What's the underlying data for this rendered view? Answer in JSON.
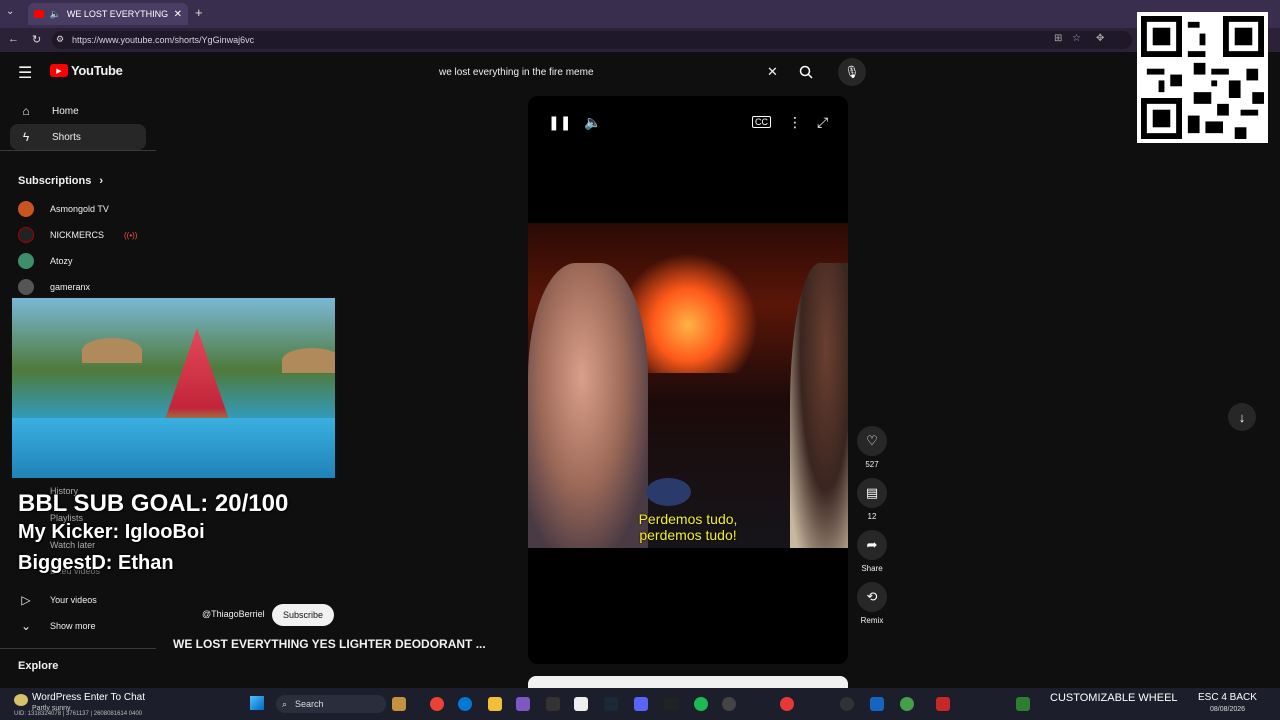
{
  "browser": {
    "tab_title": "WE LOST EVERYTHING YES LI",
    "url": "https://www.youtube.com/shorts/YgGinwaj6vc"
  },
  "yt": {
    "logo": "YouTube",
    "search_value": "we lost everything in the fire meme",
    "nav": [
      {
        "label": "Home",
        "icon": "home-icon"
      },
      {
        "label": "Shorts",
        "icon": "shorts-icon"
      }
    ],
    "subs_header": "Subscriptions",
    "subs": [
      "Asmongold TV",
      "NICKMERCS",
      "Atozy",
      "gameranx"
    ],
    "you_items": [
      "History",
      "Playlists",
      "Watch later",
      "Liked videos",
      "Your videos",
      "Show more"
    ],
    "explore": "Explore",
    "channel": "@ThiagoBerriel",
    "subscribe": "Subscribe",
    "video_title": "WE LOST EVERYTHING YES LIGHTER DEODORANT ...",
    "subtitle_line1": "Perdemos tudo,",
    "subtitle_line2": "perdemos tudo!",
    "likes": "527",
    "comments": "12",
    "share": "Share",
    "remix": "Remix"
  },
  "overlay": {
    "line1": "BBL SUB GOAL: 20/100",
    "line2": "My Kicker: IglooBoi",
    "line3": "BiggestD: Ethan"
  },
  "taskbar": {
    "left_label": "WordPress Enter To Chat",
    "weather": "Partly sunny",
    "search": "Search",
    "right_label": "CUSTOMIZABLE WHEEL",
    "right_label2": "ESC 4 BACK",
    "date": "08/08/2026",
    "status": "UID: 1318324078 | 3761137 | 2608081614 0400"
  },
  "colors": {
    "accent": "#ff0000",
    "taskbar": "#1c1f2b",
    "browser": "#3a2e4f"
  }
}
